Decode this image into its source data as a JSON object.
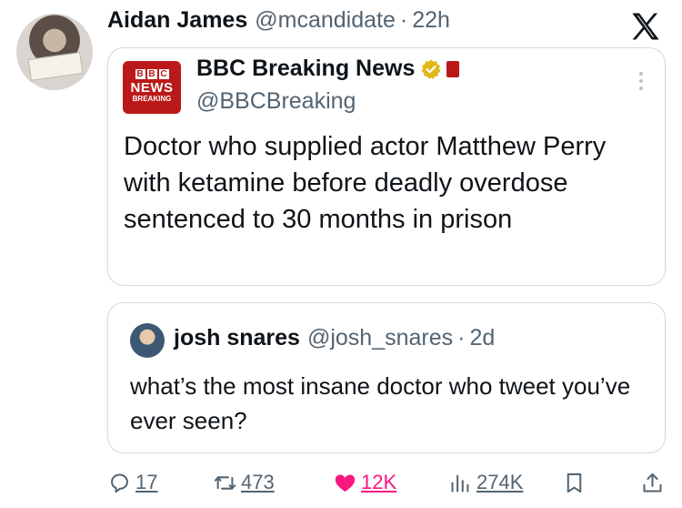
{
  "tweet": {
    "author_name": "Aidan James",
    "author_handle": "@mcandidate",
    "separator": "·",
    "time": "22h"
  },
  "quoted": {
    "name": "BBC Breaking News",
    "handle": "@BBCBreaking",
    "logo_text": {
      "blocks": [
        "B",
        "B",
        "C"
      ],
      "news": "NEWS",
      "breaking": "BREAKING"
    },
    "text": "Doctor who supplied actor Matthew Perry with ketamine before deadly overdose sentenced to 30 months in prison"
  },
  "reply": {
    "name": "josh snares",
    "handle": "@josh_snares",
    "separator": "·",
    "time": "2d",
    "text": "what’s the most insane doctor who tweet you’ve ever seen?"
  },
  "actions": {
    "replies": "17",
    "reposts": "473",
    "likes": "12K",
    "views": "274K"
  },
  "colors": {
    "like": "#f91880",
    "bbc_red": "#bb1919",
    "verified_gold": "#e2b719",
    "muted": "#536471"
  },
  "icons": [
    "x-logo-icon",
    "verified-badge-icon",
    "more-icon",
    "reply-icon",
    "repost-icon",
    "like-icon",
    "views-icon",
    "bookmark-icon",
    "share-icon"
  ]
}
